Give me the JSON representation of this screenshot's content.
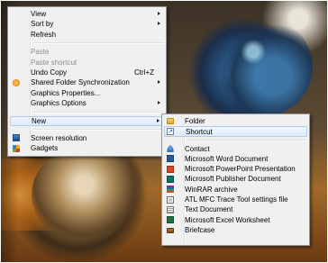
{
  "context_menu": {
    "items": [
      {
        "label": "View",
        "submenu": true,
        "enabled": true
      },
      {
        "label": "Sort by",
        "submenu": true,
        "enabled": true
      },
      {
        "label": "Refresh",
        "submenu": false,
        "enabled": true
      },
      {
        "label": "Paste",
        "submenu": false,
        "enabled": false
      },
      {
        "label": "Paste shortcut",
        "submenu": false,
        "enabled": false
      },
      {
        "label": "Undo Copy",
        "shortcut": "Ctrl+Z",
        "enabled": true
      },
      {
        "label": "Shared Folder Synchronization",
        "submenu": true,
        "enabled": true,
        "icon": "shared-folder-sync-icon"
      },
      {
        "label": "Graphics Properties...",
        "submenu": false,
        "enabled": true
      },
      {
        "label": "Graphics Options",
        "submenu": true,
        "enabled": true
      },
      {
        "label": "New",
        "submenu": true,
        "enabled": true,
        "highlighted": true
      },
      {
        "label": "Screen resolution",
        "submenu": false,
        "enabled": true,
        "icon": "screen-resolution-icon"
      },
      {
        "label": "Gadgets",
        "submenu": false,
        "enabled": true,
        "icon": "gadgets-icon"
      }
    ]
  },
  "new_submenu": {
    "items": [
      {
        "label": "Folder",
        "icon": "folder-icon"
      },
      {
        "label": "Shortcut",
        "icon": "shortcut-icon",
        "highlighted": true
      },
      {
        "label": "Contact",
        "icon": "contact-icon"
      },
      {
        "label": "Microsoft Word Document",
        "icon": "word-document-icon"
      },
      {
        "label": "Microsoft PowerPoint Presentation",
        "icon": "powerpoint-presentation-icon"
      },
      {
        "label": "Microsoft Publisher Document",
        "icon": "publisher-document-icon"
      },
      {
        "label": "WinRAR archive",
        "icon": "winrar-archive-icon"
      },
      {
        "label": "ATL MFC Trace Tool settings file",
        "icon": "atl-mfc-settings-icon"
      },
      {
        "label": "Text Document",
        "icon": "text-document-icon"
      },
      {
        "label": "Microsoft Excel Worksheet",
        "icon": "excel-worksheet-icon"
      },
      {
        "label": "Briefcase",
        "icon": "briefcase-icon"
      }
    ]
  },
  "colors": {
    "menu_background": "#f0f0f0",
    "highlight_fill": "#dbe9f9",
    "highlight_border": "#aecbf0",
    "disabled_text": "#8d8d8d"
  }
}
